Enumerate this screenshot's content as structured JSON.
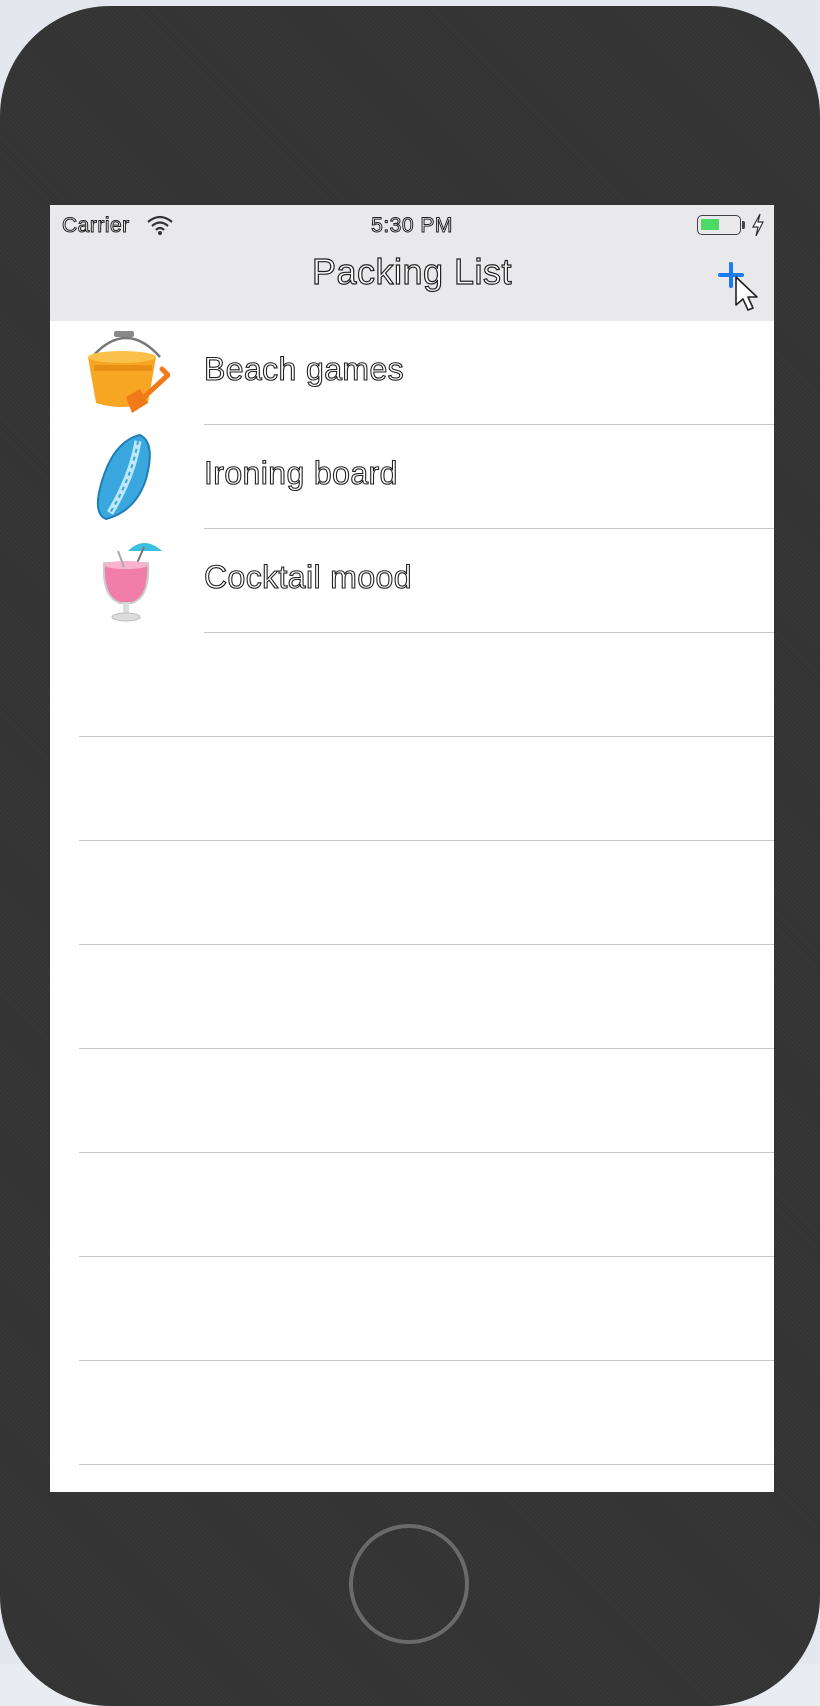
{
  "status_bar": {
    "carrier": "Carrier",
    "time": "5:30 PM",
    "battery_level": 0.5
  },
  "nav": {
    "title": "Packing List",
    "add_icon": "plus-icon"
  },
  "items": [
    {
      "label": "Beach games",
      "icon": "bucket-spade-icon"
    },
    {
      "label": "Ironing board",
      "icon": "surfboard-icon"
    },
    {
      "label": "Cocktail mood",
      "icon": "cocktail-icon"
    }
  ],
  "empty_rows": 8,
  "colors": {
    "accent": "#1a7cf0",
    "nav_background": "#e9e9ec",
    "separator": "#c8c7cc",
    "battery": "#4cd964"
  }
}
